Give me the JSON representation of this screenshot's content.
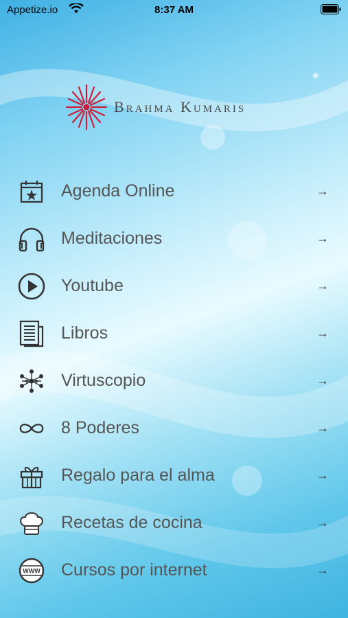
{
  "status": {
    "carrier": "Appetize.io",
    "time": "8:37 AM"
  },
  "logo": {
    "text": "Brahma Kumaris"
  },
  "menu": [
    {
      "label": "Agenda Online",
      "icon": "calendar-star-icon"
    },
    {
      "label": "Meditaciones",
      "icon": "headphones-icon"
    },
    {
      "label": "Youtube",
      "icon": "play-circle-icon"
    },
    {
      "label": "Libros",
      "icon": "document-icon"
    },
    {
      "label": "Virtuscopio",
      "icon": "network-icon"
    },
    {
      "label": "8 Poderes",
      "icon": "infinity-icon"
    },
    {
      "label": "Regalo para el alma",
      "icon": "gift-icon"
    },
    {
      "label": "Recetas de cocina",
      "icon": "chef-hat-icon"
    },
    {
      "label": "Cursos por internet",
      "icon": "www-globe-icon"
    }
  ],
  "colors": {
    "accent_logo": "#c8203a",
    "label_text": "#555555"
  }
}
